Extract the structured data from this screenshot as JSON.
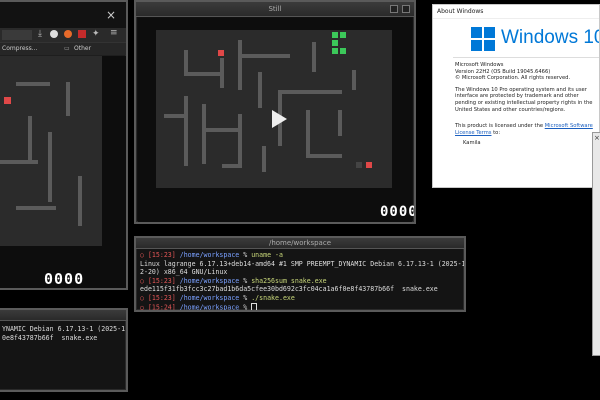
{
  "browser": {
    "bookmarks": [
      "Compress...",
      "Other Bookmarks"
    ],
    "close_glyph": "×",
    "score": "0000"
  },
  "snake": {
    "title": "Still",
    "score": "0000",
    "play_icon": "play-icon"
  },
  "about": {
    "title": "About Windows",
    "logo_text": "Windows 10",
    "lines": [
      "Microsoft Windows",
      "Version 22H2 (OS Build 19045.6466)",
      "© Microsoft Corporation. All rights reserved."
    ],
    "para1": "The Windows 10 Pro operating system and its user interface are protected by trademark and other pending or existing intellectual property rights in the United States and other countries/regions.",
    "license_prefix": "This product is licensed under the ",
    "license_link": "Microsoft Software License Terms",
    "license_suffix": " to:",
    "user": "Kamila"
  },
  "terminal_main": {
    "title": "/home/workspace",
    "lines": [
      {
        "time": "[15:23]",
        "path": "/home/workspace",
        "cmd": "uname -a"
      },
      {
        "out": "Linux lagrange 6.17.13+deb14-amd64 #1 SMP PREEMPT_DYNAMIC Debian 6.17.13-1 (2025-1"
      },
      {
        "out": "2-20) x86_64 GNU/Linux"
      },
      {
        "time": "[15:23]",
        "path": "/home/workspace",
        "cmd": "sha256sum snake.exe"
      },
      {
        "out": "ede115f31fb3fcc3c27bad1b6da5cfee30bd692c3fc04ca1a6f0e8f43787b66f  snake.exe"
      },
      {
        "time": "[15:23]",
        "path": "/home/workspace",
        "cmd": "./snake.exe"
      },
      {
        "time": "[15:24]",
        "path": "/home/workspace",
        "cmd": ""
      }
    ]
  },
  "terminal_bottom": {
    "lines": [
      "YNAMIC Debian 6.17.13-1 (2025-1",
      "",
      "0e8f43787b66f  snake.exe"
    ]
  },
  "colors": {
    "wall": "#5b5b5b",
    "floor": "#2b2b2b",
    "snake": "#3cc85a",
    "food": "#e04848",
    "accent_blue": "#0078d7"
  }
}
